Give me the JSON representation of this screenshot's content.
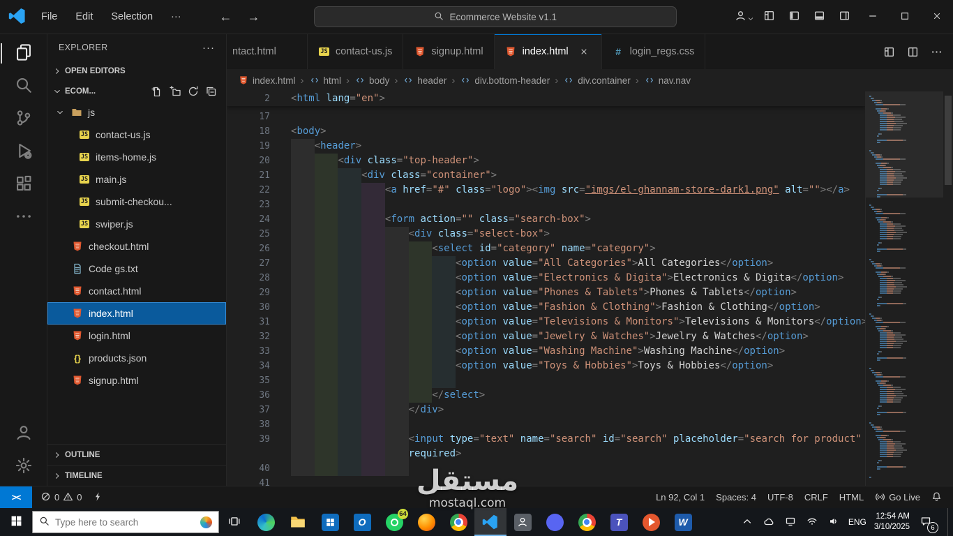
{
  "titlebar": {
    "menus": [
      "File",
      "Edit",
      "Selection",
      "···"
    ],
    "search_label": "Ecommerce Website v1.1"
  },
  "explorer": {
    "title": "EXPLORER",
    "more": "···",
    "open_editors_label": "OPEN EDITORS",
    "project_label": "ECOM...",
    "outline_label": "OUTLINE",
    "timeline_label": "TIMELINE",
    "tree": [
      {
        "label": "js",
        "icon": "folder",
        "type": "folder",
        "indent": 0
      },
      {
        "label": "contact-us.js",
        "icon": "js",
        "indent": 1
      },
      {
        "label": "items-home.js",
        "icon": "js",
        "indent": 1
      },
      {
        "label": "main.js",
        "icon": "js",
        "indent": 1
      },
      {
        "label": "submit-checkou...",
        "icon": "js",
        "indent": 1
      },
      {
        "label": "swiper.js",
        "icon": "js",
        "indent": 1
      },
      {
        "label": "checkout.html",
        "icon": "html",
        "indent": 0
      },
      {
        "label": "Code gs.txt",
        "icon": "txt",
        "indent": 0
      },
      {
        "label": "contact.html",
        "icon": "html",
        "indent": 0
      },
      {
        "label": "index.html",
        "icon": "html",
        "indent": 0,
        "selected": true
      },
      {
        "label": "login.html",
        "icon": "html",
        "indent": 0
      },
      {
        "label": "products.json",
        "icon": "json",
        "indent": 0
      },
      {
        "label": "signup.html",
        "icon": "html",
        "indent": 0
      }
    ]
  },
  "tabs": [
    {
      "label": "ntact.html",
      "icon": "html",
      "partial": true
    },
    {
      "label": "contact-us.js",
      "icon": "js"
    },
    {
      "label": "signup.html",
      "icon": "html"
    },
    {
      "label": "index.html",
      "icon": "html",
      "active": true
    },
    {
      "label": "login_regs.css",
      "icon": "css"
    }
  ],
  "breadcrumbs": [
    {
      "label": "index.html",
      "icon": "html"
    },
    {
      "label": "html",
      "icon": "sym"
    },
    {
      "label": "body",
      "icon": "sym"
    },
    {
      "label": "header",
      "icon": "sym"
    },
    {
      "label": "div.bottom-header",
      "icon": "sym"
    },
    {
      "label": "div.container",
      "icon": "sym"
    },
    {
      "label": "nav.nav",
      "icon": "sym"
    }
  ],
  "editor": {
    "sticky": {
      "n": "2",
      "i": 0,
      "t": [
        [
          "p",
          "<"
        ],
        [
          "t",
          "html"
        ],
        [
          "x",
          " "
        ],
        [
          "a",
          "lang"
        ],
        [
          "p",
          "="
        ],
        [
          "s",
          "\"en\""
        ],
        [
          "p",
          ">"
        ]
      ]
    },
    "lines": [
      {
        "n": "17",
        "i": 0,
        "t": []
      },
      {
        "n": "18",
        "i": 0,
        "t": [
          [
            "p",
            "<"
          ],
          [
            "t",
            "body"
          ],
          [
            "p",
            ">"
          ]
        ]
      },
      {
        "n": "19",
        "i": 4,
        "t": [
          [
            "p",
            "<"
          ],
          [
            "t",
            "header"
          ],
          [
            "p",
            ">"
          ]
        ]
      },
      {
        "n": "20",
        "i": 8,
        "t": [
          [
            "p",
            "<"
          ],
          [
            "t",
            "div"
          ],
          [
            "x",
            " "
          ],
          [
            "a",
            "class"
          ],
          [
            "p",
            "="
          ],
          [
            "s",
            "\"top-header\""
          ],
          [
            "p",
            ">"
          ]
        ]
      },
      {
        "n": "21",
        "i": 12,
        "t": [
          [
            "p",
            "<"
          ],
          [
            "t",
            "div"
          ],
          [
            "x",
            " "
          ],
          [
            "a",
            "class"
          ],
          [
            "p",
            "="
          ],
          [
            "s",
            "\"container\""
          ],
          [
            "p",
            ">"
          ]
        ]
      },
      {
        "n": "22",
        "i": 16,
        "t": [
          [
            "p",
            "<"
          ],
          [
            "t",
            "a"
          ],
          [
            "x",
            " "
          ],
          [
            "a",
            "href"
          ],
          [
            "p",
            "="
          ],
          [
            "s",
            "\"#\""
          ],
          [
            "x",
            " "
          ],
          [
            "a",
            "class"
          ],
          [
            "p",
            "="
          ],
          [
            "s",
            "\"logo\""
          ],
          [
            "p",
            "><"
          ],
          [
            "t",
            "img"
          ],
          [
            "x",
            " "
          ],
          [
            "a",
            "src"
          ],
          [
            "p",
            "="
          ],
          [
            "u",
            "\"imgs/el-ghannam-store-dark1.png\""
          ],
          [
            "x",
            " "
          ],
          [
            "a",
            "alt"
          ],
          [
            "p",
            "="
          ],
          [
            "s",
            "\"\""
          ],
          [
            "p",
            "></"
          ],
          [
            "t",
            "a"
          ],
          [
            "p",
            ">"
          ]
        ]
      },
      {
        "n": "23",
        "i": 16,
        "t": []
      },
      {
        "n": "24",
        "i": 16,
        "t": [
          [
            "p",
            "<"
          ],
          [
            "t",
            "form"
          ],
          [
            "x",
            " "
          ],
          [
            "a",
            "action"
          ],
          [
            "p",
            "="
          ],
          [
            "s",
            "\"\""
          ],
          [
            "x",
            " "
          ],
          [
            "a",
            "class"
          ],
          [
            "p",
            "="
          ],
          [
            "s",
            "\"search-box\""
          ],
          [
            "p",
            ">"
          ]
        ]
      },
      {
        "n": "25",
        "i": 20,
        "t": [
          [
            "p",
            "<"
          ],
          [
            "t",
            "div"
          ],
          [
            "x",
            " "
          ],
          [
            "a",
            "class"
          ],
          [
            "p",
            "="
          ],
          [
            "s",
            "\"select-box\""
          ],
          [
            "p",
            ">"
          ]
        ]
      },
      {
        "n": "26",
        "i": 24,
        "t": [
          [
            "p",
            "<"
          ],
          [
            "t",
            "select"
          ],
          [
            "x",
            " "
          ],
          [
            "a",
            "id"
          ],
          [
            "p",
            "="
          ],
          [
            "s",
            "\"category\""
          ],
          [
            "x",
            " "
          ],
          [
            "a",
            "name"
          ],
          [
            "p",
            "="
          ],
          [
            "s",
            "\"category\""
          ],
          [
            "p",
            ">"
          ]
        ]
      },
      {
        "n": "27",
        "i": 28,
        "t": [
          [
            "p",
            "<"
          ],
          [
            "t",
            "option"
          ],
          [
            "x",
            " "
          ],
          [
            "a",
            "value"
          ],
          [
            "p",
            "="
          ],
          [
            "s",
            "\"All Categories\""
          ],
          [
            "p",
            ">"
          ],
          [
            "x",
            "All Categories"
          ],
          [
            "p",
            "</"
          ],
          [
            "t",
            "option"
          ],
          [
            "p",
            ">"
          ]
        ]
      },
      {
        "n": "28",
        "i": 28,
        "t": [
          [
            "p",
            "<"
          ],
          [
            "t",
            "option"
          ],
          [
            "x",
            " "
          ],
          [
            "a",
            "value"
          ],
          [
            "p",
            "="
          ],
          [
            "s",
            "\"Electronics & Digita\""
          ],
          [
            "p",
            ">"
          ],
          [
            "x",
            "Electronics & Digita"
          ],
          [
            "p",
            "</"
          ],
          [
            "t",
            "option"
          ],
          [
            "p",
            ">"
          ]
        ]
      },
      {
        "n": "29",
        "i": 28,
        "t": [
          [
            "p",
            "<"
          ],
          [
            "t",
            "option"
          ],
          [
            "x",
            " "
          ],
          [
            "a",
            "value"
          ],
          [
            "p",
            "="
          ],
          [
            "s",
            "\"Phones & Tablets\""
          ],
          [
            "p",
            ">"
          ],
          [
            "x",
            "Phones & Tablets"
          ],
          [
            "p",
            "</"
          ],
          [
            "t",
            "option"
          ],
          [
            "p",
            ">"
          ]
        ]
      },
      {
        "n": "30",
        "i": 28,
        "t": [
          [
            "p",
            "<"
          ],
          [
            "t",
            "option"
          ],
          [
            "x",
            " "
          ],
          [
            "a",
            "value"
          ],
          [
            "p",
            "="
          ],
          [
            "s",
            "\"Fashion & Clothing\""
          ],
          [
            "p",
            ">"
          ],
          [
            "x",
            "Fashion & Clothing"
          ],
          [
            "p",
            "</"
          ],
          [
            "t",
            "option"
          ],
          [
            "p",
            ">"
          ]
        ]
      },
      {
        "n": "31",
        "i": 28,
        "t": [
          [
            "p",
            "<"
          ],
          [
            "t",
            "option"
          ],
          [
            "x",
            " "
          ],
          [
            "a",
            "value"
          ],
          [
            "p",
            "="
          ],
          [
            "s",
            "\"Televisions & Monitors\""
          ],
          [
            "p",
            ">"
          ],
          [
            "x",
            "Televisions & Monitors"
          ],
          [
            "p",
            "</"
          ],
          [
            "t",
            "option"
          ],
          [
            "p",
            ">"
          ]
        ]
      },
      {
        "n": "32",
        "i": 28,
        "t": [
          [
            "p",
            "<"
          ],
          [
            "t",
            "option"
          ],
          [
            "x",
            " "
          ],
          [
            "a",
            "value"
          ],
          [
            "p",
            "="
          ],
          [
            "s",
            "\"Jewelry & Watches\""
          ],
          [
            "p",
            ">"
          ],
          [
            "x",
            "Jewelry & Watches"
          ],
          [
            "p",
            "</"
          ],
          [
            "t",
            "option"
          ],
          [
            "p",
            ">"
          ]
        ]
      },
      {
        "n": "33",
        "i": 28,
        "t": [
          [
            "p",
            "<"
          ],
          [
            "t",
            "option"
          ],
          [
            "x",
            " "
          ],
          [
            "a",
            "value"
          ],
          [
            "p",
            "="
          ],
          [
            "s",
            "\"Washing Machine\""
          ],
          [
            "p",
            ">"
          ],
          [
            "x",
            "Washing Machine"
          ],
          [
            "p",
            "</"
          ],
          [
            "t",
            "option"
          ],
          [
            "p",
            ">"
          ]
        ]
      },
      {
        "n": "34",
        "i": 28,
        "t": [
          [
            "p",
            "<"
          ],
          [
            "t",
            "option"
          ],
          [
            "x",
            " "
          ],
          [
            "a",
            "value"
          ],
          [
            "p",
            "="
          ],
          [
            "s",
            "\"Toys & Hobbies\""
          ],
          [
            "p",
            ">"
          ],
          [
            "x",
            "Toys & Hobbies"
          ],
          [
            "p",
            "</"
          ],
          [
            "t",
            "option"
          ],
          [
            "p",
            ">"
          ]
        ]
      },
      {
        "n": "35",
        "i": 28,
        "t": []
      },
      {
        "n": "36",
        "i": 24,
        "t": [
          [
            "p",
            "</"
          ],
          [
            "t",
            "select"
          ],
          [
            "p",
            ">"
          ]
        ]
      },
      {
        "n": "37",
        "i": 20,
        "t": [
          [
            "p",
            "</"
          ],
          [
            "t",
            "div"
          ],
          [
            "p",
            ">"
          ]
        ]
      },
      {
        "n": "38",
        "i": 20,
        "t": []
      },
      {
        "n": "39",
        "i": 20,
        "t": [
          [
            "p",
            "<"
          ],
          [
            "t",
            "input"
          ],
          [
            "x",
            " "
          ],
          [
            "a",
            "type"
          ],
          [
            "p",
            "="
          ],
          [
            "s",
            "\"text\""
          ],
          [
            "x",
            " "
          ],
          [
            "a",
            "name"
          ],
          [
            "p",
            "="
          ],
          [
            "s",
            "\"search\""
          ],
          [
            "x",
            " "
          ],
          [
            "a",
            "id"
          ],
          [
            "p",
            "="
          ],
          [
            "s",
            "\"search\""
          ],
          [
            "x",
            " "
          ],
          [
            "a",
            "placeholder"
          ],
          [
            "p",
            "="
          ],
          [
            "s",
            "\"search for product\""
          ]
        ]
      },
      {
        "n": "",
        "i": 20,
        "t": [
          [
            "a",
            "required"
          ],
          [
            "p",
            ">"
          ]
        ]
      },
      {
        "n": "40",
        "i": 20,
        "t": []
      },
      {
        "n": "41",
        "i": 0,
        "t": []
      }
    ]
  },
  "status_bar": {
    "errors": "0",
    "warnings": "0",
    "line_col": "Ln 92, Col 1",
    "indent": "Spaces: 4",
    "encoding": "UTF-8",
    "eol": "CRLF",
    "language": "HTML",
    "go_live": "Go Live"
  },
  "taskbar": {
    "search_placeholder": "Type here to search",
    "language": "ENG",
    "time": "12:54 AM",
    "date": "3/10/2025",
    "notification_count": "6",
    "apps": [
      {
        "name": "edge"
      },
      {
        "name": "file-explorer"
      },
      {
        "name": "store"
      },
      {
        "name": "outlook",
        "glyph": "O"
      },
      {
        "name": "whatsapp",
        "badge": "64"
      },
      {
        "name": "firefox"
      },
      {
        "name": "chrome"
      },
      {
        "name": "vscode",
        "active": true
      },
      {
        "name": "people"
      },
      {
        "name": "discord"
      },
      {
        "name": "chrome-alt"
      },
      {
        "name": "teams",
        "glyph": "T"
      },
      {
        "name": "media"
      },
      {
        "name": "word",
        "glyph": "W"
      }
    ]
  },
  "watermark": {
    "arabic": "مستقل",
    "latin": "mostaql.com"
  }
}
